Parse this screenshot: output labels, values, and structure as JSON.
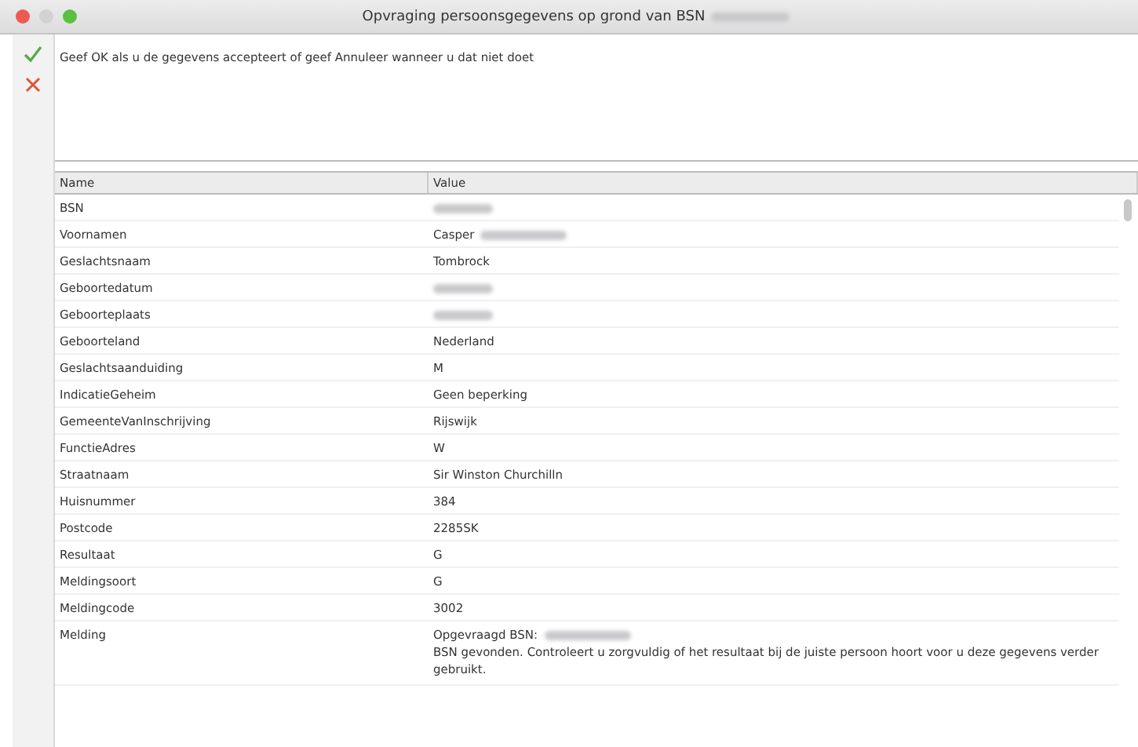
{
  "window": {
    "title": "Opvraging persoonsgegevens op grond van BSN",
    "title_redacted": true
  },
  "toolbar": [
    {
      "kind": "accept"
    },
    {
      "kind": "cancel"
    }
  ],
  "message": "Geef OK als u de gegevens accepteert of geef Annuleer wanneer u dat niet doet",
  "table": {
    "columns": [
      "Name",
      "Value"
    ],
    "rows": [
      {
        "name": "BSN",
        "redacted": true
      },
      {
        "name": "Voornamen",
        "value": "Casper",
        "redacted": true
      },
      {
        "name": "Geslachtsnaam",
        "value": "Tombrock"
      },
      {
        "name": "Geboortedatum",
        "redacted": true
      },
      {
        "name": "Geboorteplaats",
        "redacted": true
      },
      {
        "name": "Geboorteland",
        "value": "Nederland"
      },
      {
        "name": "Geslachtsaanduiding",
        "value": "M"
      },
      {
        "name": "IndicatieGeheim",
        "value": "Geen beperking"
      },
      {
        "name": "GemeenteVanInschrijving",
        "value": "Rijswijk"
      },
      {
        "name": "FunctieAdres",
        "value": "W"
      },
      {
        "name": "Straatnaam",
        "value": "Sir Winston Churchilln"
      },
      {
        "name": "Huisnummer",
        "value": "384"
      },
      {
        "name": "Postcode",
        "value": "2285SK"
      },
      {
        "name": "Resultaat",
        "value": "G"
      },
      {
        "name": "Meldingsoort",
        "value": "G"
      },
      {
        "name": "Meldingcode",
        "value": "3002"
      },
      {
        "name": "Melding",
        "value": "Opgevraagd BSN:",
        "redacted": true,
        "note": "BSN gevonden. Controleert u zorgvuldig of het resultaat bij de juiste persoon hoort voor u deze gegevens verder gebruikt."
      }
    ]
  }
}
